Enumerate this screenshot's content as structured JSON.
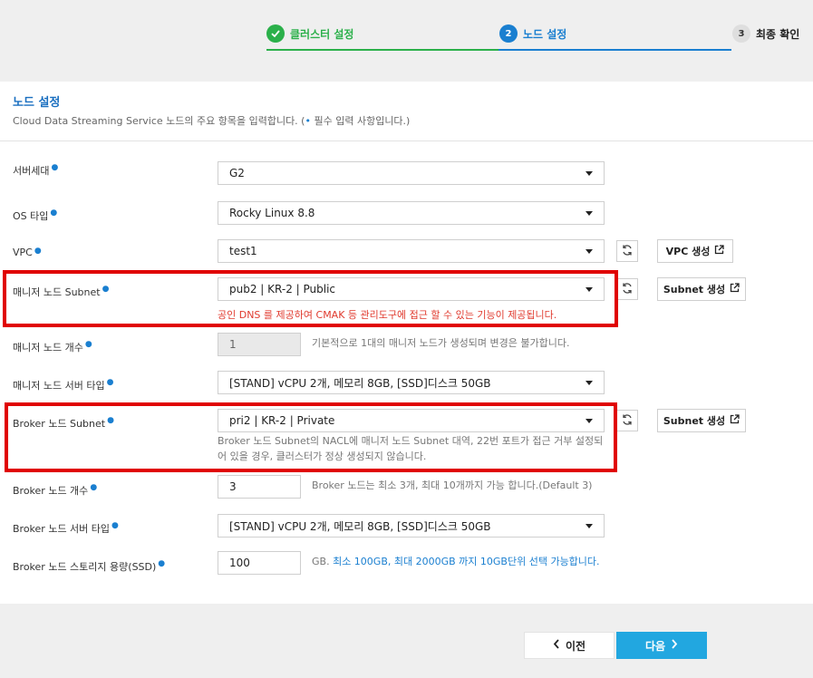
{
  "stepper": {
    "steps": [
      {
        "number": "1",
        "label": "클러스터 설정",
        "state": "done"
      },
      {
        "number": "2",
        "label": "노드 설정",
        "state": "active"
      },
      {
        "number": "3",
        "label": "최종 확인",
        "state": "pending"
      }
    ],
    "colors": {
      "done": "#2bb04a",
      "active": "#1a7fd0",
      "pending": "#dedede"
    }
  },
  "section": {
    "title": "노드 설정",
    "desc_before": "Cloud Data Streaming Service 노드의 주요 항목을 입력합니다. (",
    "desc_dot": "•",
    "desc_after": " 필수 입력 사항입니다.)"
  },
  "form": {
    "server_gen": {
      "label": "서버세대",
      "value": "G2"
    },
    "os_type": {
      "label": "OS 타입",
      "value": "Rocky Linux 8.8"
    },
    "vpc": {
      "label": "VPC",
      "value": "test1",
      "create_label": "VPC 생성"
    },
    "manager_subnet": {
      "label": "매니저 노드 Subnet",
      "value": "pub2 | KR-2 | Public",
      "create_label": "Subnet 생성",
      "warning": "공인 DNS 를 제공하여 CMAK 등 관리도구에 접근 할 수 있는 기능이 제공됩니다."
    },
    "manager_count": {
      "label": "매니저 노드 개수",
      "value": "1",
      "note": "기본적으로 1대의 매니저 노드가 생성되며 변경은 불가합니다."
    },
    "manager_server_type": {
      "label": "매니저 노드 서버 타입",
      "value": "[STAND] vCPU 2개, 메모리 8GB, [SSD]디스크 50GB"
    },
    "broker_subnet": {
      "label": "Broker 노드 Subnet",
      "value": "pri2 | KR-2 | Private",
      "create_label": "Subnet 생성",
      "note": "Broker 노드 Subnet의 NACL에 매니저 노드 Subnet 대역, 22번 포트가 접근 거부 설정되어 있을 경우, 클러스터가 정상 생성되지 않습니다."
    },
    "broker_count": {
      "label": "Broker 노드 개수",
      "value": "3",
      "note": "Broker 노드는 최소 3개, 최대 10개까지 가능 합니다.(Default 3)"
    },
    "broker_server_type": {
      "label": "Broker 노드 서버 타입",
      "value": "[STAND] vCPU 2개, 메모리 8GB, [SSD]디스크 50GB"
    },
    "broker_storage": {
      "label": "Broker 노드 스토리지 용량(SSD)",
      "value": "100",
      "note_prefix": "GB.",
      "note_blue": " 최소 100GB, 최대 2000GB 까지 10GB단위 선택 가능합니다."
    }
  },
  "footer": {
    "prev_label": "이전",
    "next_label": "다음"
  },
  "colors": {
    "accent": "#1a7fd0",
    "success": "#2bb04a",
    "primary_button": "#22a7e0",
    "highlight_box": "#e00000",
    "warning_text": "#e03a2e"
  }
}
